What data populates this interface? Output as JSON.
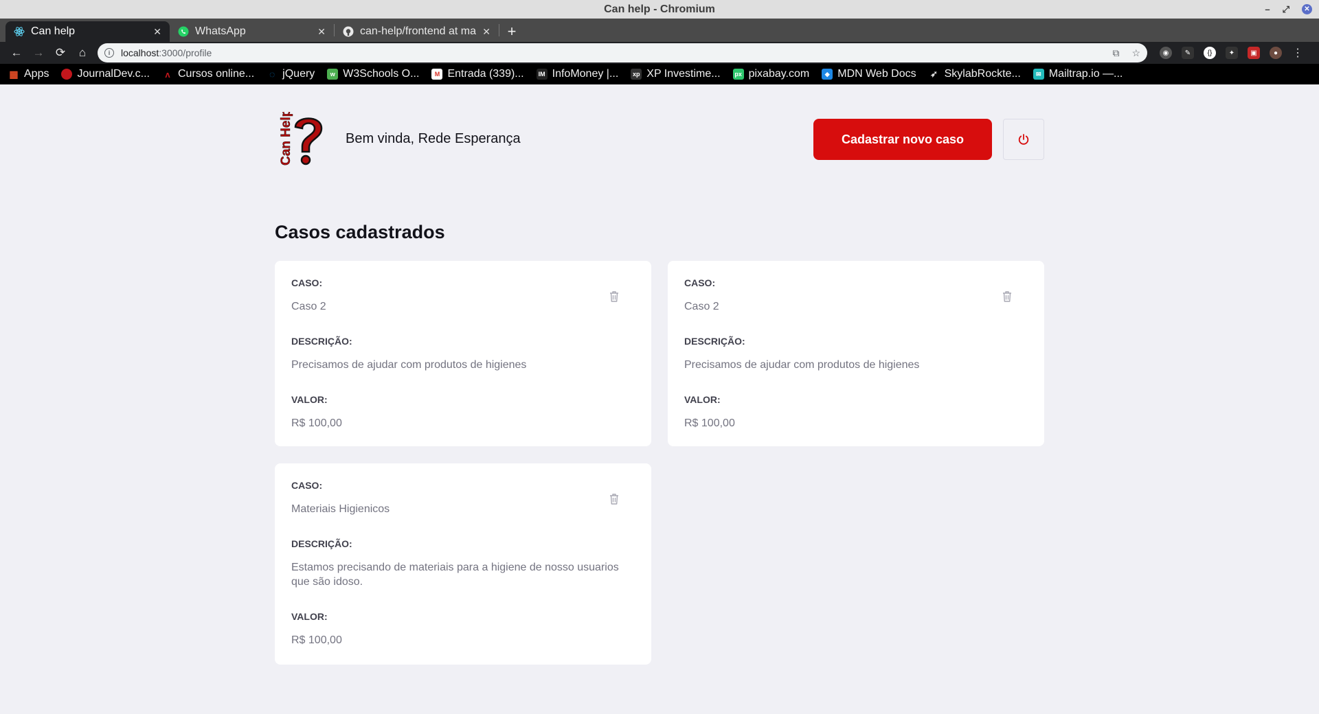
{
  "window": {
    "title": "Can help - Chromium"
  },
  "tabs": [
    {
      "label": "Can help",
      "icon": "react-icon",
      "active": true
    },
    {
      "label": "WhatsApp",
      "icon": "whatsapp-icon",
      "active": false
    },
    {
      "label": "can-help/frontend at ma",
      "icon": "github-icon",
      "active": false
    }
  ],
  "omnibox": {
    "host": "localhost",
    "path": ":3000/profile"
  },
  "bookmarks": [
    {
      "label": "Apps",
      "color": "#e44d26"
    },
    {
      "label": "JournalDev.c...",
      "color": "#c3161c"
    },
    {
      "label": "Cursos online...",
      "color": "#c3161c"
    },
    {
      "label": "jQuery",
      "color": "#0769ad"
    },
    {
      "label": "W3Schools O...",
      "color": "#4caf50"
    },
    {
      "label": "Entrada (339)...",
      "color": "#d93025"
    },
    {
      "label": "InfoMoney |...",
      "color": "#222222"
    },
    {
      "label": "XP Investime...",
      "color": "#333333"
    },
    {
      "label": "pixabay.com",
      "color": "#2ec66d"
    },
    {
      "label": "MDN Web Docs",
      "color": "#1e88e5"
    },
    {
      "label": "SkylabRockte...",
      "color": "#444444"
    },
    {
      "label": "Mailtrap.io —...",
      "color": "#22bbbb"
    }
  ],
  "header": {
    "logo_text": "Can Help",
    "welcome": "Bem vinda, Rede Esperança",
    "new_case_label": "Cadastrar novo caso"
  },
  "main": {
    "title": "Casos cadastrados",
    "labels": {
      "case": "CASO:",
      "description": "DESCRIÇÃO:",
      "value": "VALOR:"
    },
    "cases": [
      {
        "title": "Caso 2",
        "description": "Precisamos de ajudar com produtos de higienes",
        "value": "R$ 100,00"
      },
      {
        "title": "Caso 2",
        "description": "Precisamos de ajudar com produtos de higienes",
        "value": "R$ 100,00"
      },
      {
        "title": "Materiais Higienicos",
        "description": "Estamos precisando de materiais para a higiene de nosso usuarios que são idoso.",
        "value": "R$ 100,00"
      }
    ]
  },
  "colors": {
    "brand_red": "#d70d0d",
    "page_bg": "#f0f0f5"
  }
}
